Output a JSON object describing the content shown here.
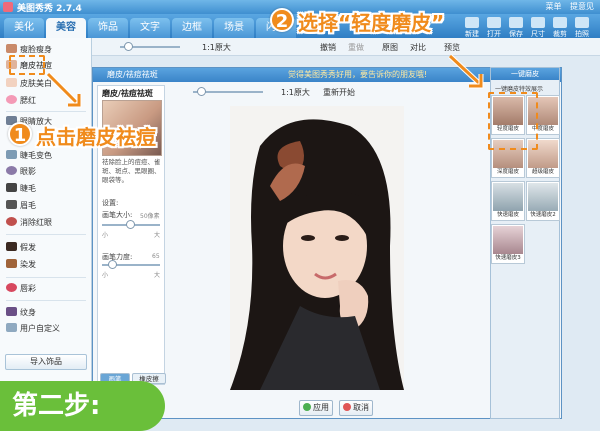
{
  "app": {
    "title": "美图秀秀 2.7.4",
    "top_links": [
      "菜单",
      "提意见"
    ]
  },
  "tabs": [
    "美化",
    "美容",
    "饰品",
    "文字",
    "边框",
    "场景",
    "闪图"
  ],
  "active_tab": "美容",
  "toolbar_buttons": [
    "新建",
    "打开",
    "保存",
    "尺寸",
    "裁剪",
    "拍照"
  ],
  "left_menu": [
    "瘦脸瘦身",
    "磨皮祛痘",
    "皮肤美白",
    "腮红",
    "眼睛放大",
    "睫毛变色",
    "眼影",
    "睫毛",
    "眉毛",
    "消除红眼",
    "假发",
    "染发",
    "唇彩",
    "纹身",
    "用户自定义"
  ],
  "import_button": "导入饰品",
  "main_toolbar": {
    "zoom_label": "1:1原大",
    "undo": "撤销",
    "redo": "重做",
    "original": "原图",
    "compare": "对比",
    "preview": "预览"
  },
  "dialog": {
    "title": "磨皮/祛痘祛斑",
    "center_hint": "觉得美图秀秀好用，要告诉你的朋友哦!",
    "close": "×",
    "panel_title": "磨皮/祛痘祛斑",
    "desc": "祛除脸上的痘痘、雀斑、斑点、黑眼圈、眼袋等。",
    "settings_label": "设置:",
    "brush_size_label": "画笔大小:",
    "brush_size_value": "50像素",
    "brush_size_min": "小",
    "brush_size_max": "大",
    "brush_strength_label": "画笔力度:",
    "brush_strength_value": "65",
    "brush_strength_min": "小",
    "brush_strength_max": "大",
    "mode_tabs": [
      "画笔",
      "橡皮擦"
    ],
    "zoom_label": "1:1原大",
    "restart": "重新开始",
    "apply": "应用",
    "cancel": "取消"
  },
  "effects_panel": {
    "header": "一键磨皮",
    "subtitle": "一键磨皮特效展示",
    "items": [
      "轻度磨皮",
      "中度磨皮",
      "深度磨皮",
      "超级磨皮",
      "快速磨皮",
      "快速磨皮2",
      "快速磨皮3"
    ]
  },
  "annotations": {
    "step1_number": "1",
    "step1_text": "点击磨皮祛痘",
    "step2_number": "2",
    "step2_text": "选择“轻度磨皮”",
    "step_badge": "第二步:"
  },
  "colors": {
    "accent": "#f08b1c",
    "badge": "#6abf3a",
    "titlebar": "#3f8fd0"
  }
}
